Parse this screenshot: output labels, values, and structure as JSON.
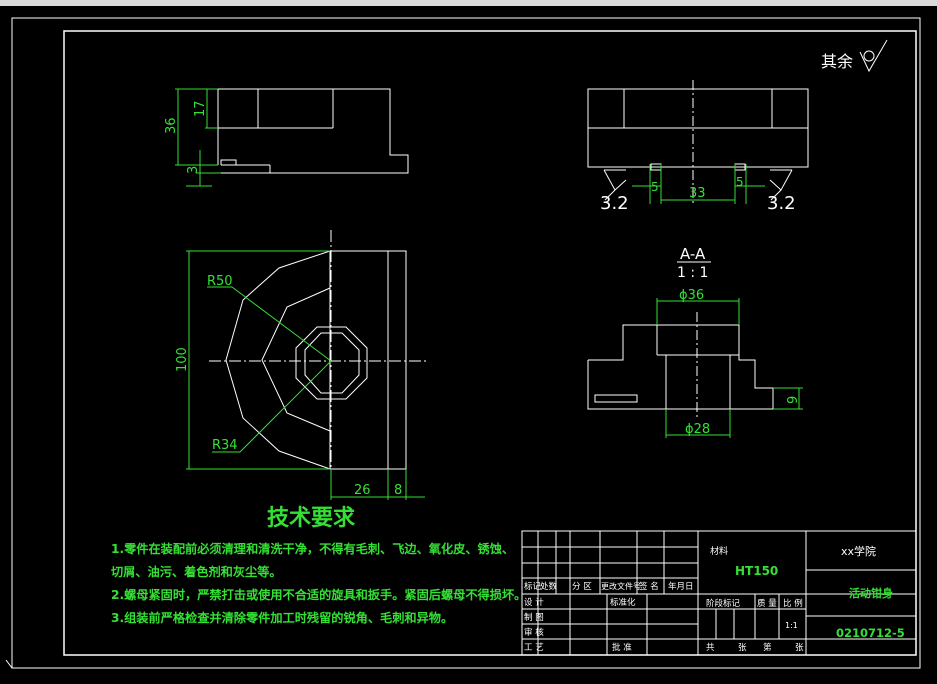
{
  "surface_finish": {
    "rest_label": "其余",
    "values": [
      "3.2",
      "3.2"
    ]
  },
  "dimensions": {
    "front_height": "36",
    "front_upper": "17",
    "front_lower": "3",
    "right_gap_left": "5",
    "right_width": "33",
    "right_gap_right": "5",
    "plan_radius_outer": "R50",
    "plan_radius_inner": "R34",
    "plan_height": "100",
    "plan_width_a": "26",
    "plan_width_b": "8",
    "section_top_dia": "ϕ36",
    "section_bottom_dia": "ϕ28",
    "section_step": "9"
  },
  "section": {
    "name": "A-A",
    "scale": "1 : 1"
  },
  "tech_requirements": {
    "title": "技术要求",
    "items": [
      "1.零件在装配前必须清理和清洗干净，不得有毛刺、飞边、氧化皮、锈蚀、",
      "切屑、油污、着色剂和灰尘等。",
      "2.螺母紧固时，严禁打击或使用不合适的旋具和扳手。紧固后螺母不得损坏。",
      "3.组装前严格检查并清除零件加工时残留的锐角、毛刺和异物。"
    ]
  },
  "title_block": {
    "material_label": "材料",
    "material": "HT150",
    "school": "xx学院",
    "part_name": "活动钳身",
    "drawing_no": "0210712-5",
    "headers": [
      "标记",
      "处数",
      "分 区",
      "更改文件号",
      "签 名",
      "年月日"
    ],
    "rows": [
      "设 计",
      "制 图",
      "审 核",
      "工 艺"
    ],
    "standardize": "标准化",
    "approve": "批 准",
    "stage_mark": "阶段标记",
    "weight": "质 量",
    "scale_label": "比 例",
    "scale": "1:1",
    "total": "共",
    "sheets": "张",
    "sheet_no": "第",
    "sheets2": "张"
  }
}
